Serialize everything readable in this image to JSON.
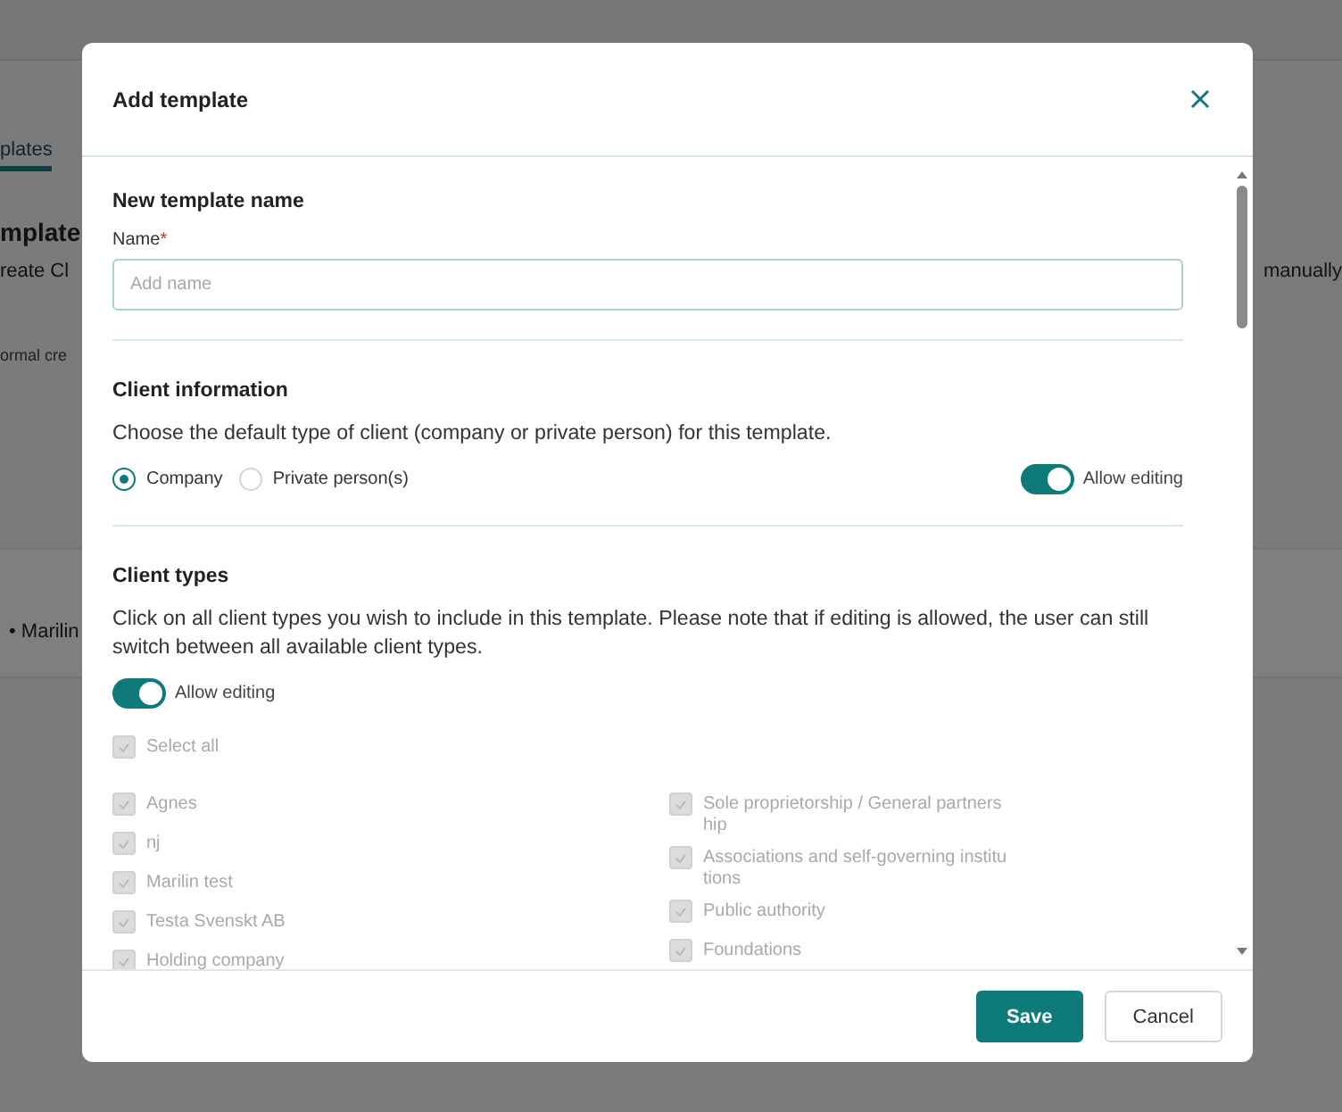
{
  "background": {
    "tab": "plates",
    "heading": "mplate",
    "line_1": "reate Cl",
    "line_1_right": "manually",
    "line_2": "ormal cre",
    "list_item": "• Marilin"
  },
  "dialog": {
    "title": "Add template",
    "name_section": {
      "heading": "New template name",
      "label": "Name",
      "required": true,
      "required_mark": "*",
      "placeholder": "Add name"
    },
    "client_information": {
      "heading": "Client information",
      "description": "Choose the default type of client (company or private person) for this template.",
      "options": [
        {
          "label": "Company",
          "selected": true
        },
        {
          "label": "Private person(s)",
          "selected": false
        }
      ],
      "allow_editing": {
        "label": "Allow editing",
        "on": true
      }
    },
    "client_types": {
      "heading": "Client types",
      "description": "Click on all client types you wish to include in this template. Please note that if editing is allowed, the user can still switch between all available client types.",
      "allow_editing": {
        "label": "Allow editing",
        "on": true
      },
      "select_all": {
        "label": "Select all",
        "checked": true,
        "disabled": true
      },
      "columns": [
        [
          {
            "label": "Agnes",
            "checked": true,
            "disabled": true
          },
          {
            "label": "nj",
            "checked": true,
            "disabled": true
          },
          {
            "label": "Marilin test",
            "checked": true,
            "disabled": true
          },
          {
            "label": "Testa Svenskt AB",
            "checked": true,
            "disabled": true
          },
          {
            "label": "Holding company",
            "checked": true,
            "disabled": true
          }
        ],
        [
          {
            "label": "Sole proprietorship / General partnership",
            "checked": true,
            "disabled": true
          },
          {
            "label": "Associations and self-governing institutions",
            "checked": true,
            "disabled": true
          },
          {
            "label": "Public authority",
            "checked": true,
            "disabled": true
          },
          {
            "label": "Foundations",
            "checked": true,
            "disabled": true
          }
        ]
      ]
    },
    "buttons": [
      {
        "label": "Save",
        "kind": "primary"
      },
      {
        "label": "Cancel",
        "kind": "secondary"
      }
    ]
  }
}
